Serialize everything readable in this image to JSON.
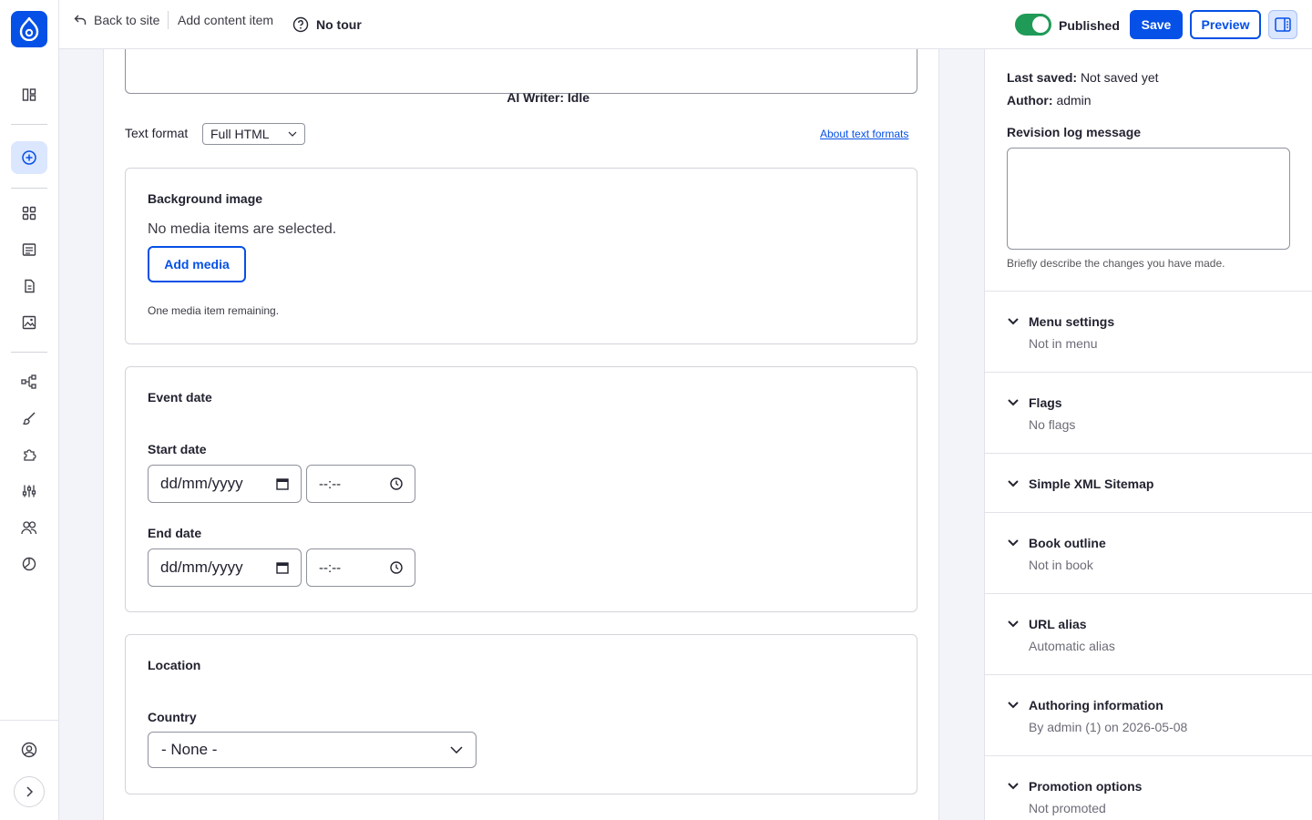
{
  "topbar": {
    "back_label": "Back to site",
    "add_content_label": "Add content item",
    "tour_label": "No tour",
    "published_label": "Published",
    "save_label": "Save",
    "preview_label": "Preview"
  },
  "editor": {
    "ai_status": "AI Writer: Idle",
    "text_format_label": "Text format",
    "text_format_value": "Full HTML",
    "about_formats_label": "About text formats"
  },
  "background_image": {
    "title": "Background image",
    "empty_text": "No media items are selected.",
    "add_media_label": "Add media",
    "remaining_text": "One media item remaining."
  },
  "event_date": {
    "title": "Event date",
    "start_label": "Start date",
    "end_label": "End date",
    "date_placeholder": "dd/mm/yyyy",
    "time_placeholder": "--:--"
  },
  "location": {
    "title": "Location",
    "country_label": "Country",
    "country_value": "- None -"
  },
  "sidebar": {
    "last_saved_label": "Last saved:",
    "last_saved_value": "Not saved yet",
    "author_label": "Author:",
    "author_value": "admin",
    "revision_label": "Revision log message",
    "revision_help": "Briefly describe the changes you have made.",
    "sections": [
      {
        "title": "Menu settings",
        "summary": "Not in menu"
      },
      {
        "title": "Flags",
        "summary": "No flags"
      },
      {
        "title": "Simple XML Sitemap",
        "summary": ""
      },
      {
        "title": "Book outline",
        "summary": "Not in book"
      },
      {
        "title": "URL alias",
        "summary": "Automatic alias"
      },
      {
        "title": "Authoring information",
        "summary": "By admin (1) on 2026-05-08"
      },
      {
        "title": "Promotion options",
        "summary": "Not promoted"
      }
    ]
  },
  "colors": {
    "accent": "#0550e6",
    "toggle_on": "#1f9b57"
  },
  "icons": [
    "drupal-logo-icon",
    "structure-icon",
    "create-icon",
    "dashboard-icon",
    "content-icon",
    "files-icon",
    "media-icon",
    "structure-tree-icon",
    "appearance-icon",
    "extend-icon",
    "configuration-icon",
    "people-icon",
    "reports-icon",
    "user-icon",
    "expand-icon"
  ]
}
